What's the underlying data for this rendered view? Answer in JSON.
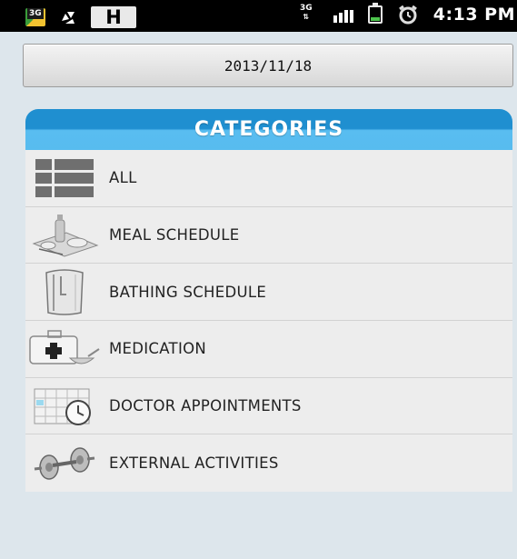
{
  "status_bar": {
    "network_badge": "3G",
    "data_indicator": "3G",
    "time": "4:13 PM",
    "icons": [
      "network-3g-icon",
      "recycle-icon",
      "h-icon",
      "data-3g-icon",
      "signal-icon",
      "battery-icon",
      "alarm-icon"
    ],
    "h_label": "H"
  },
  "date_button": {
    "label": "2013/11/18"
  },
  "categories": {
    "header": "CATEGORIES",
    "header_color": "#1f8fd0",
    "items": [
      {
        "label": "ALL",
        "icon": "grid-icon"
      },
      {
        "label": "MEAL SCHEDULE",
        "icon": "meal-tray-icon"
      },
      {
        "label": "BATHING SCHEDULE",
        "icon": "shower-icon"
      },
      {
        "label": "MEDICATION",
        "icon": "medicine-kit-icon"
      },
      {
        "label": "DOCTOR APPOINTMENTS",
        "icon": "calendar-clock-icon"
      },
      {
        "label": "EXTERNAL ACTIVITIES",
        "icon": "dumbbell-icon"
      }
    ]
  }
}
